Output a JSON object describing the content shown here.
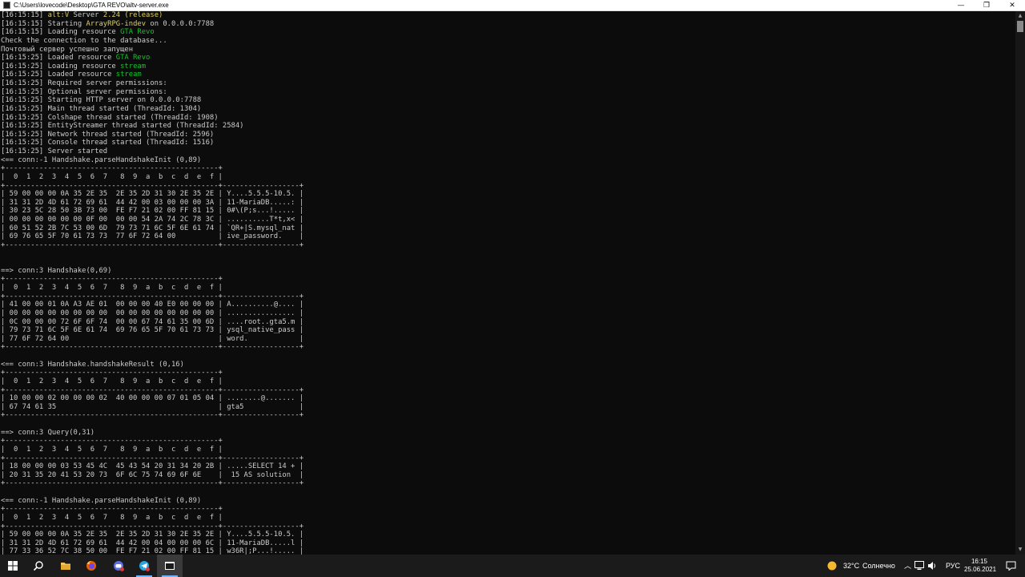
{
  "window": {
    "title": "C:\\Users\\lovecode\\Desktop\\GTA REVO\\altv-server.exe",
    "minimize_glyph": "—",
    "maximize_glyph": "❐",
    "close_glyph": "✕"
  },
  "console_lines": [
    [
      {
        "t": "[16:15:15] "
      },
      {
        "t": "alt:V",
        "c": "yellow"
      },
      {
        "t": " Server "
      },
      {
        "t": "2.24 (release)",
        "c": "yellow"
      }
    ],
    [
      {
        "t": "[16:15:15] Starting "
      },
      {
        "t": "ArrayRPG-indev",
        "c": "yellow"
      },
      {
        "t": " on 0.0.0.0:7788"
      }
    ],
    [
      {
        "t": "[16:15:15] Loading resource "
      },
      {
        "t": "GTA Revo",
        "c": "green"
      }
    ],
    [
      {
        "t": "Check the connection to the database..."
      }
    ],
    [
      {
        "t": "Почтовый сервер успешно запущен"
      }
    ],
    [
      {
        "t": "[16:15:25] Loaded resource "
      },
      {
        "t": "GTA Revo",
        "c": "green"
      }
    ],
    [
      {
        "t": "[16:15:25] Loading resource "
      },
      {
        "t": "stream",
        "c": "green"
      }
    ],
    [
      {
        "t": "[16:15:25] Loaded resource "
      },
      {
        "t": "stream",
        "c": "green"
      }
    ],
    [
      {
        "t": "[16:15:25] Required server permissions:"
      }
    ],
    [
      {
        "t": "[16:15:25] Optional server permissions:"
      }
    ],
    [
      {
        "t": "[16:15:25] Starting HTTP server on 0.0.0.0:7788"
      }
    ],
    [
      {
        "t": "[16:15:25] Main thread started (ThreadId: 1304)"
      }
    ],
    [
      {
        "t": "[16:15:25] Colshape thread started (ThreadId: 1908)"
      }
    ],
    [
      {
        "t": "[16:15:25] EntityStreamer thread started (ThreadId: 2584)"
      }
    ],
    [
      {
        "t": "[16:15:25] Network thread started (ThreadId: 2596)"
      }
    ],
    [
      {
        "t": "[16:15:25] Console thread started (ThreadId: 1516)"
      }
    ],
    [
      {
        "t": "[16:15:25] Server started"
      }
    ],
    [
      {
        "t": "<== conn:-1 Handshake.parseHandshakeInit (0,89)"
      }
    ],
    [
      {
        "t": "+--------------------------------------------------+"
      }
    ],
    [
      {
        "t": "|  0  1  2  3  4  5  6  7   8  9  a  b  c  d  e  f |"
      }
    ],
    [
      {
        "t": "+--------------------------------------------------+------------------+"
      }
    ],
    [
      {
        "t": "| 59 00 00 00 0A 35 2E 35  2E 35 2D 31 30 2E 35 2E | Y....5.5.5-10.5. |"
      }
    ],
    [
      {
        "t": "| 31 31 2D 4D 61 72 69 61  44 42 00 03 00 00 00 3A | 11-MariaDB.....: |"
      }
    ],
    [
      {
        "t": "| 30 23 5C 28 50 3B 73 00  FE F7 21 02 00 FF 81 15 | 0#\\(P;s...!..... |"
      }
    ],
    [
      {
        "t": "| 00 00 00 00 00 00 0F 00  00 00 54 2A 74 2C 78 3C | ..........T*t,x< |"
      }
    ],
    [
      {
        "t": "| 60 51 52 2B 7C 53 00 6D  79 73 71 6C 5F 6E 61 74 | `QR+|S.mysql_nat |"
      }
    ],
    [
      {
        "t": "| 69 76 65 5F 70 61 73 73  77 6F 72 64 00          | ive_password.    |"
      }
    ],
    [
      {
        "t": "+--------------------------------------------------+------------------+"
      }
    ],
    [
      {
        "t": ""
      }
    ],
    [
      {
        "t": ""
      }
    ],
    [
      {
        "t": "==> conn:3 Handshake(0,69)"
      }
    ],
    [
      {
        "t": "+--------------------------------------------------+"
      }
    ],
    [
      {
        "t": "|  0  1  2  3  4  5  6  7   8  9  a  b  c  d  e  f |"
      }
    ],
    [
      {
        "t": "+--------------------------------------------------+------------------+"
      }
    ],
    [
      {
        "t": "| 41 00 00 01 0A A3 AE 01  00 00 00 40 E0 00 00 00 | A..........@.... |"
      }
    ],
    [
      {
        "t": "| 00 00 00 00 00 00 00 00  00 00 00 00 00 00 00 00 | ................ |"
      }
    ],
    [
      {
        "t": "| 0C 00 00 00 72 6F 6F 74  00 00 67 74 61 35 00 6D | ....root..gta5.m |"
      }
    ],
    [
      {
        "t": "| 79 73 71 6C 5F 6E 61 74  69 76 65 5F 70 61 73 73 | ysql_native_pass |"
      }
    ],
    [
      {
        "t": "| 77 6F 72 64 00                                   | word.            |"
      }
    ],
    [
      {
        "t": "+--------------------------------------------------+------------------+"
      }
    ],
    [
      {
        "t": ""
      }
    ],
    [
      {
        "t": "<== conn:3 Handshake.handshakeResult (0,16)"
      }
    ],
    [
      {
        "t": "+--------------------------------------------------+"
      }
    ],
    [
      {
        "t": "|  0  1  2  3  4  5  6  7   8  9  a  b  c  d  e  f |"
      }
    ],
    [
      {
        "t": "+--------------------------------------------------+------------------+"
      }
    ],
    [
      {
        "t": "| 10 00 00 02 00 00 00 02  40 00 00 00 07 01 05 04 | ........@....... |"
      }
    ],
    [
      {
        "t": "| 67 74 61 35                                      | gta5             |"
      }
    ],
    [
      {
        "t": "+--------------------------------------------------+------------------+"
      }
    ],
    [
      {
        "t": ""
      }
    ],
    [
      {
        "t": "==> conn:3 Query(0,31)"
      }
    ],
    [
      {
        "t": "+--------------------------------------------------+"
      }
    ],
    [
      {
        "t": "|  0  1  2  3  4  5  6  7   8  9  a  b  c  d  e  f |"
      }
    ],
    [
      {
        "t": "+--------------------------------------------------+------------------+"
      }
    ],
    [
      {
        "t": "| 18 00 00 00 03 53 45 4C  45 43 54 20 31 34 20 2B | .....SELECT 14 + |"
      }
    ],
    [
      {
        "t": "| 20 31 35 20 41 53 20 73  6F 6C 75 74 69 6F 6E    |  15 AS solution  |"
      }
    ],
    [
      {
        "t": "+--------------------------------------------------+------------------+"
      }
    ],
    [
      {
        "t": ""
      }
    ],
    [
      {
        "t": "<== conn:-1 Handshake.parseHandshakeInit (0,89)"
      }
    ],
    [
      {
        "t": "+--------------------------------------------------+"
      }
    ],
    [
      {
        "t": "|  0  1  2  3  4  5  6  7   8  9  a  b  c  d  e  f |"
      }
    ],
    [
      {
        "t": "+--------------------------------------------------+------------------+"
      }
    ],
    [
      {
        "t": "| 59 00 00 00 0A 35 2E 35  2E 35 2D 31 30 2E 35 2E | Y....5.5.5-10.5. |"
      }
    ],
    [
      {
        "t": "| 31 31 2D 4D 61 72 69 61  44 42 00 04 00 00 00 6C | 11-MariaDB.....l |"
      }
    ],
    [
      {
        "t": "| 77 33 36 52 7C 38 50 00  FE F7 21 02 00 FF 81 15 | w36R|;P...!..... |"
      }
    ]
  ],
  "colors": {
    "console_bg": "#0c0c0c",
    "console_text": "#cccccc",
    "green": "#13c32b",
    "yellow": "#dccd66",
    "taskbar_bg": "#1b1b1b"
  },
  "taskbar": {
    "items": [
      {
        "name": "start-button",
        "icon": "windows-logo-icon"
      },
      {
        "name": "search-button",
        "icon": "search-icon"
      },
      {
        "name": "file-explorer-button",
        "icon": "folder-icon"
      },
      {
        "name": "firefox-button",
        "icon": "firefox-icon"
      },
      {
        "name": "app-button",
        "icon": "chat-app-icon"
      },
      {
        "name": "telegram-button",
        "icon": "telegram-icon"
      },
      {
        "name": "console-button",
        "icon": "console-window-icon"
      }
    ],
    "weather_temp": "32°C",
    "weather_desc": "Солнечно",
    "language": "РУС",
    "time": "16:15",
    "date": "25.06.2021"
  }
}
